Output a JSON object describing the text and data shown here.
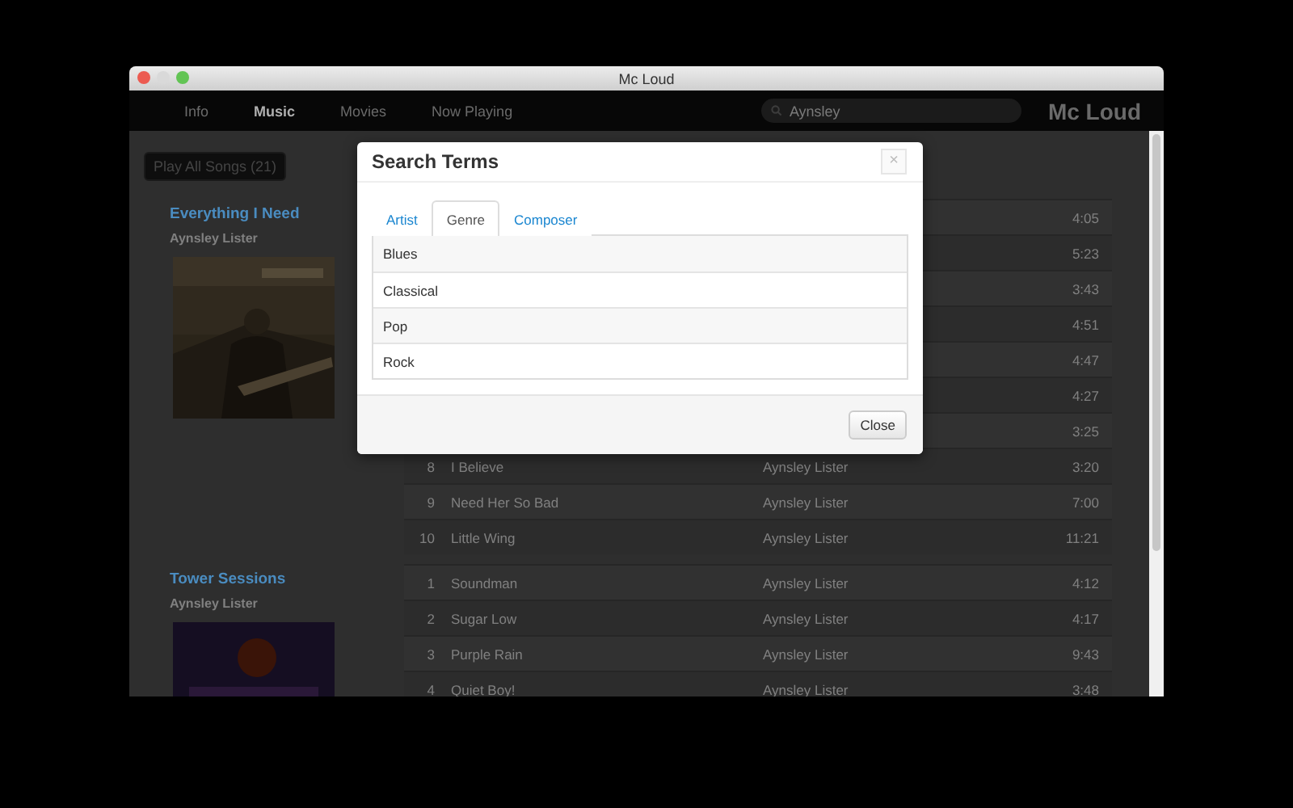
{
  "window": {
    "title": "Mc Loud"
  },
  "nav": {
    "items": [
      {
        "label": "Info",
        "selected": false
      },
      {
        "label": "Music",
        "selected": true
      },
      {
        "label": "Movies",
        "selected": false
      },
      {
        "label": "Now Playing",
        "selected": false
      }
    ],
    "search": {
      "value": "Aynsley"
    },
    "brand": "Mc Loud"
  },
  "play_all_button": "Play All Songs (21)",
  "albums": [
    {
      "title": "Everything I Need",
      "artist": "Aynsley Lister",
      "tracks": [
        {
          "duration": "4:05"
        },
        {
          "duration": "5:23"
        },
        {
          "duration": "3:43"
        },
        {
          "duration": "4:51"
        },
        {
          "duration": "4:47"
        },
        {
          "duration": "4:27"
        },
        {
          "duration": "3:25"
        },
        {
          "number": "8",
          "title": "I Believe",
          "artist": "Aynsley Lister",
          "duration": "3:20"
        },
        {
          "number": "9",
          "title": "Need Her So Bad",
          "artist": "Aynsley Lister",
          "duration": "7:00"
        },
        {
          "number": "10",
          "title": "Little Wing",
          "artist": "Aynsley Lister",
          "duration": "11:21"
        }
      ]
    },
    {
      "title": "Tower Sessions",
      "artist": "Aynsley Lister",
      "tracks": [
        {
          "number": "1",
          "title": "Soundman",
          "artist": "Aynsley Lister",
          "duration": "4:12"
        },
        {
          "number": "2",
          "title": "Sugar Low",
          "artist": "Aynsley Lister",
          "duration": "4:17"
        },
        {
          "number": "3",
          "title": "Purple Rain",
          "artist": "Aynsley Lister",
          "duration": "9:43"
        },
        {
          "number": "4",
          "title": "Quiet Boy!",
          "artist": "Aynsley Lister",
          "duration": "3:48"
        }
      ]
    }
  ],
  "modal": {
    "title": "Search Terms",
    "close_icon": "×",
    "tabs": [
      {
        "label": "Artist",
        "selected": false
      },
      {
        "label": "Genre",
        "selected": true
      },
      {
        "label": "Composer",
        "selected": false
      }
    ],
    "items": [
      "Blues",
      "Classical",
      "Pop",
      "Rock"
    ],
    "close_button": "Close"
  }
}
